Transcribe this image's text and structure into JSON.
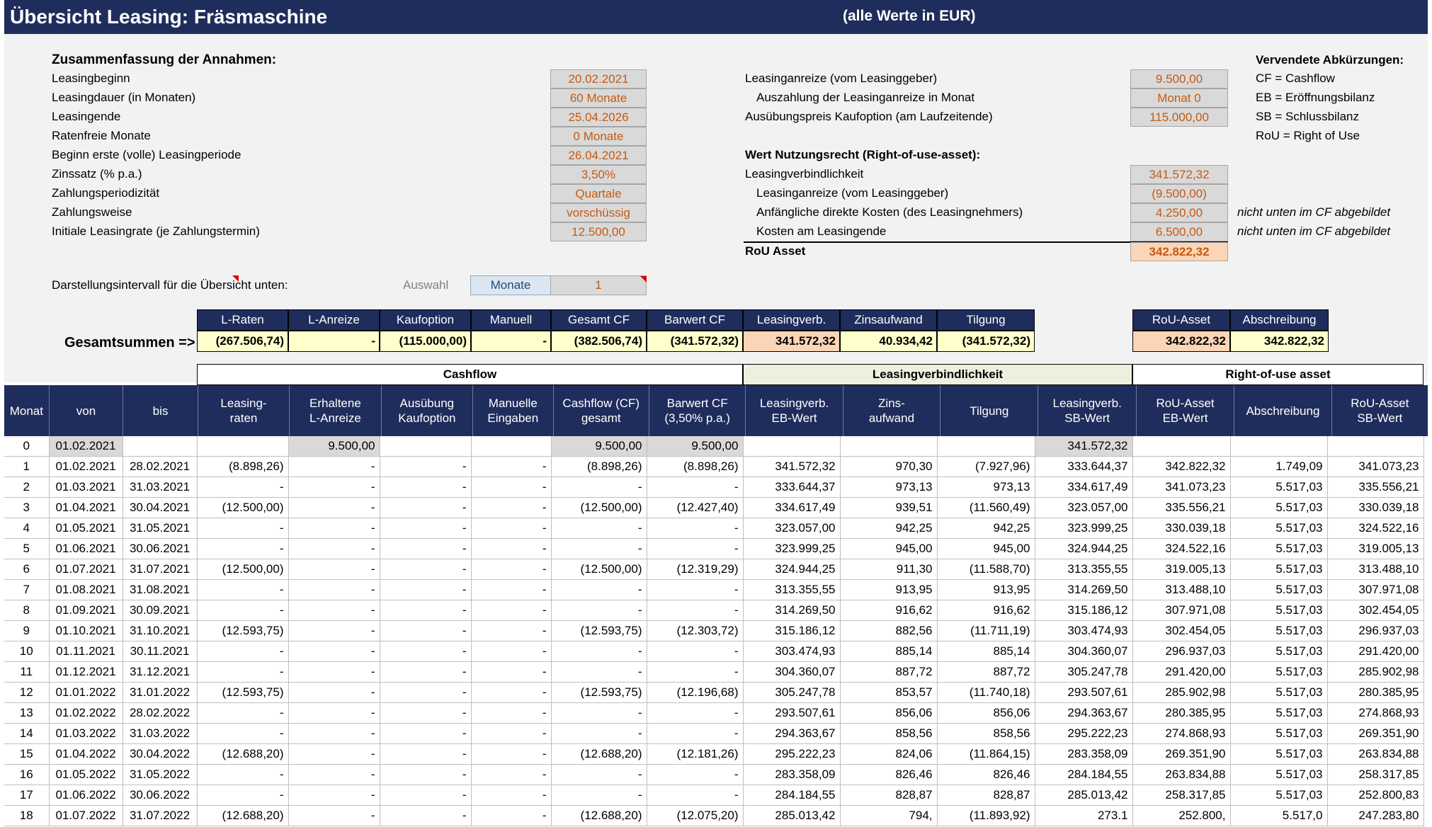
{
  "title": "Übersicht Leasing: Fräsmaschine",
  "subtitle": "(alle Werte in EUR)",
  "assumptions": {
    "heading": "Zusammenfassung der Annahmen:",
    "items": [
      {
        "label": "Leasingbeginn",
        "value": "20.02.2021"
      },
      {
        "label": "Leasingdauer (in Monaten)",
        "value": "60 Monate"
      },
      {
        "label": "Leasingende",
        "value": "25.04.2026"
      },
      {
        "label": "Ratenfreie Monate",
        "value": "0 Monate"
      },
      {
        "label": "Beginn erste (volle) Leasingperiode",
        "value": "26.04.2021"
      },
      {
        "label": "Zinssatz (% p.a.)",
        "value": "3,50%"
      },
      {
        "label": "Zahlungsperiodizität",
        "value": "Quartale"
      },
      {
        "label": "Zahlungsweise",
        "value": "vorschüssig"
      },
      {
        "label": "Initiale Leasingrate (je Zahlungstermin)",
        "value": "12.500,00"
      }
    ]
  },
  "incentives": {
    "items": [
      {
        "label": "Leasinganreize (vom Leasinggeber)",
        "value": "9.500,00"
      },
      {
        "label": "Auszahlung der Leasinganreize in Monat",
        "value": "Monat 0"
      },
      {
        "label": "Ausübungspreis Kaufoption (am Laufzeitende)",
        "value": "115.000,00"
      }
    ]
  },
  "rou": {
    "heading": "Wert Nutzungsrecht (Right-of-use-asset):",
    "items": [
      {
        "label": "Leasingverbindlichkeit",
        "value": "341.572,32",
        "note": ""
      },
      {
        "label": "Leasinganreize (vom Leasinggeber)",
        "value": "(9.500,00)",
        "note": ""
      },
      {
        "label": "Anfängliche direkte Kosten (des Leasingnehmers)",
        "value": "4.250,00",
        "note": "nicht unten im CF abgebildet"
      },
      {
        "label": "Kosten am Leasingende",
        "value": "6.500,00",
        "note": "nicht unten im CF abgebildet"
      }
    ],
    "total_label": "RoU Asset",
    "total_value": "342.822,32"
  },
  "abbreviations": {
    "heading": "Vervendete Abkürzungen:",
    "items": [
      "CF = Cashflow",
      "EB = Eröffnungsbilanz",
      "SB = Schlussbilanz",
      "RoU = Right of Use"
    ]
  },
  "interval": {
    "label": "Darstellungsintervall für die Übersicht unten:",
    "choice_label": "Auswahl",
    "unit": "Monate",
    "value": "1"
  },
  "totals": {
    "label": "Gesamtsummen =>",
    "headers": [
      "L-Raten",
      "L-Anreize",
      "Kaufoption",
      "Manuell",
      "Gesamt CF",
      "Barwert CF",
      "Leasingverb.",
      "Zinsaufwand",
      "Tilgung"
    ],
    "values": [
      "(267.506,74)",
      "-",
      "(115.000,00)",
      "-",
      "(382.506,74)",
      "(341.572,32)",
      "341.572,32",
      "40.934,42",
      "(341.572,32)"
    ],
    "rou_headers": [
      "RoU-Asset",
      "Abschreibung"
    ],
    "rou_values": [
      "342.822,32",
      "342.822,32"
    ]
  },
  "groups": {
    "cashflow": "Cashflow",
    "liability": "Leasingverbindlichkeit",
    "rou": "Right-of-use asset"
  },
  "columns": [
    {
      "l1": "Monat",
      "l2": ""
    },
    {
      "l1": "von",
      "l2": ""
    },
    {
      "l1": "bis",
      "l2": ""
    },
    {
      "l1": "Leasing-",
      "l2": "raten"
    },
    {
      "l1": "Erhaltene",
      "l2": "L-Anreize"
    },
    {
      "l1": "Ausübung",
      "l2": "Kaufoption"
    },
    {
      "l1": "Manuelle",
      "l2": "Eingaben"
    },
    {
      "l1": "Cashflow (CF)",
      "l2": "gesamt"
    },
    {
      "l1": "Barwert CF",
      "l2": "(3,50% p.a.)"
    },
    {
      "l1": "Leasingverb.",
      "l2": "EB-Wert"
    },
    {
      "l1": "Zins-",
      "l2": "aufwand"
    },
    {
      "l1": "Tilgung",
      "l2": ""
    },
    {
      "l1": "Leasingverb.",
      "l2": "SB-Wert"
    },
    {
      "l1": "RoU-Asset",
      "l2": "EB-Wert"
    },
    {
      "l1": "Abschreibung",
      "l2": ""
    },
    {
      "l1": "RoU-Asset",
      "l2": "SB-Wert"
    }
  ],
  "rows": [
    [
      "0",
      "01.02.2021",
      "",
      "",
      "9.500,00",
      "",
      "",
      "9.500,00",
      "9.500,00",
      "",
      "",
      "",
      "341.572,32",
      "",
      "",
      ""
    ],
    [
      "1",
      "01.02.2021",
      "28.02.2021",
      "(8.898,26)",
      "-",
      "-",
      "-",
      "(8.898,26)",
      "(8.898,26)",
      "341.572,32",
      "970,30",
      "(7.927,96)",
      "333.644,37",
      "342.822,32",
      "1.749,09",
      "341.073,23"
    ],
    [
      "2",
      "01.03.2021",
      "31.03.2021",
      "-",
      "-",
      "-",
      "-",
      "-",
      "-",
      "333.644,37",
      "973,13",
      "973,13",
      "334.617,49",
      "341.073,23",
      "5.517,03",
      "335.556,21"
    ],
    [
      "3",
      "01.04.2021",
      "30.04.2021",
      "(12.500,00)",
      "-",
      "-",
      "-",
      "(12.500,00)",
      "(12.427,40)",
      "334.617,49",
      "939,51",
      "(11.560,49)",
      "323.057,00",
      "335.556,21",
      "5.517,03",
      "330.039,18"
    ],
    [
      "4",
      "01.05.2021",
      "31.05.2021",
      "-",
      "-",
      "-",
      "-",
      "-",
      "-",
      "323.057,00",
      "942,25",
      "942,25",
      "323.999,25",
      "330.039,18",
      "5.517,03",
      "324.522,16"
    ],
    [
      "5",
      "01.06.2021",
      "30.06.2021",
      "-",
      "-",
      "-",
      "-",
      "-",
      "-",
      "323.999,25",
      "945,00",
      "945,00",
      "324.944,25",
      "324.522,16",
      "5.517,03",
      "319.005,13"
    ],
    [
      "6",
      "01.07.2021",
      "31.07.2021",
      "(12.500,00)",
      "-",
      "-",
      "-",
      "(12.500,00)",
      "(12.319,29)",
      "324.944,25",
      "911,30",
      "(11.588,70)",
      "313.355,55",
      "319.005,13",
      "5.517,03",
      "313.488,10"
    ],
    [
      "7",
      "01.08.2021",
      "31.08.2021",
      "-",
      "-",
      "-",
      "-",
      "-",
      "-",
      "313.355,55",
      "913,95",
      "913,95",
      "314.269,50",
      "313.488,10",
      "5.517,03",
      "307.971,08"
    ],
    [
      "8",
      "01.09.2021",
      "30.09.2021",
      "-",
      "-",
      "-",
      "-",
      "-",
      "-",
      "314.269,50",
      "916,62",
      "916,62",
      "315.186,12",
      "307.971,08",
      "5.517,03",
      "302.454,05"
    ],
    [
      "9",
      "01.10.2021",
      "31.10.2021",
      "(12.593,75)",
      "-",
      "-",
      "-",
      "(12.593,75)",
      "(12.303,72)",
      "315.186,12",
      "882,56",
      "(11.711,19)",
      "303.474,93",
      "302.454,05",
      "5.517,03",
      "296.937,03"
    ],
    [
      "10",
      "01.11.2021",
      "30.11.2021",
      "-",
      "-",
      "-",
      "-",
      "-",
      "-",
      "303.474,93",
      "885,14",
      "885,14",
      "304.360,07",
      "296.937,03",
      "5.517,03",
      "291.420,00"
    ],
    [
      "11",
      "01.12.2021",
      "31.12.2021",
      "-",
      "-",
      "-",
      "-",
      "-",
      "-",
      "304.360,07",
      "887,72",
      "887,72",
      "305.247,78",
      "291.420,00",
      "5.517,03",
      "285.902,98"
    ],
    [
      "12",
      "01.01.2022",
      "31.01.2022",
      "(12.593,75)",
      "-",
      "-",
      "-",
      "(12.593,75)",
      "(12.196,68)",
      "305.247,78",
      "853,57",
      "(11.740,18)",
      "293.507,61",
      "285.902,98",
      "5.517,03",
      "280.385,95"
    ],
    [
      "13",
      "01.02.2022",
      "28.02.2022",
      "-",
      "-",
      "-",
      "-",
      "-",
      "-",
      "293.507,61",
      "856,06",
      "856,06",
      "294.363,67",
      "280.385,95",
      "5.517,03",
      "274.868,93"
    ],
    [
      "14",
      "01.03.2022",
      "31.03.2022",
      "-",
      "-",
      "-",
      "-",
      "-",
      "-",
      "294.363,67",
      "858,56",
      "858,56",
      "295.222,23",
      "274.868,93",
      "5.517,03",
      "269.351,90"
    ],
    [
      "15",
      "01.04.2022",
      "30.04.2022",
      "(12.688,20)",
      "-",
      "-",
      "-",
      "(12.688,20)",
      "(12.181,26)",
      "295.222,23",
      "824,06",
      "(11.864,15)",
      "283.358,09",
      "269.351,90",
      "5.517,03",
      "263.834,88"
    ],
    [
      "16",
      "01.05.2022",
      "31.05.2022",
      "-",
      "-",
      "-",
      "-",
      "-",
      "-",
      "283.358,09",
      "826,46",
      "826,46",
      "284.184,55",
      "263.834,88",
      "5.517,03",
      "258.317,85"
    ],
    [
      "17",
      "01.06.2022",
      "30.06.2022",
      "-",
      "-",
      "-",
      "-",
      "-",
      "-",
      "284.184,55",
      "828,87",
      "828,87",
      "285.013,42",
      "258.317,85",
      "5.517,03",
      "252.800,83"
    ]
  ],
  "partial_row": [
    "18",
    "01.07.2022",
    "31.07.2022",
    "(12.688,20)",
    "-",
    "-",
    "-",
    "(12.688,20)",
    "(12.075,20)",
    "285.013,42",
    "794,",
    "(11.893,92)",
    "273.1",
    "252.800,",
    "5.517,0",
    "247.283,80"
  ]
}
